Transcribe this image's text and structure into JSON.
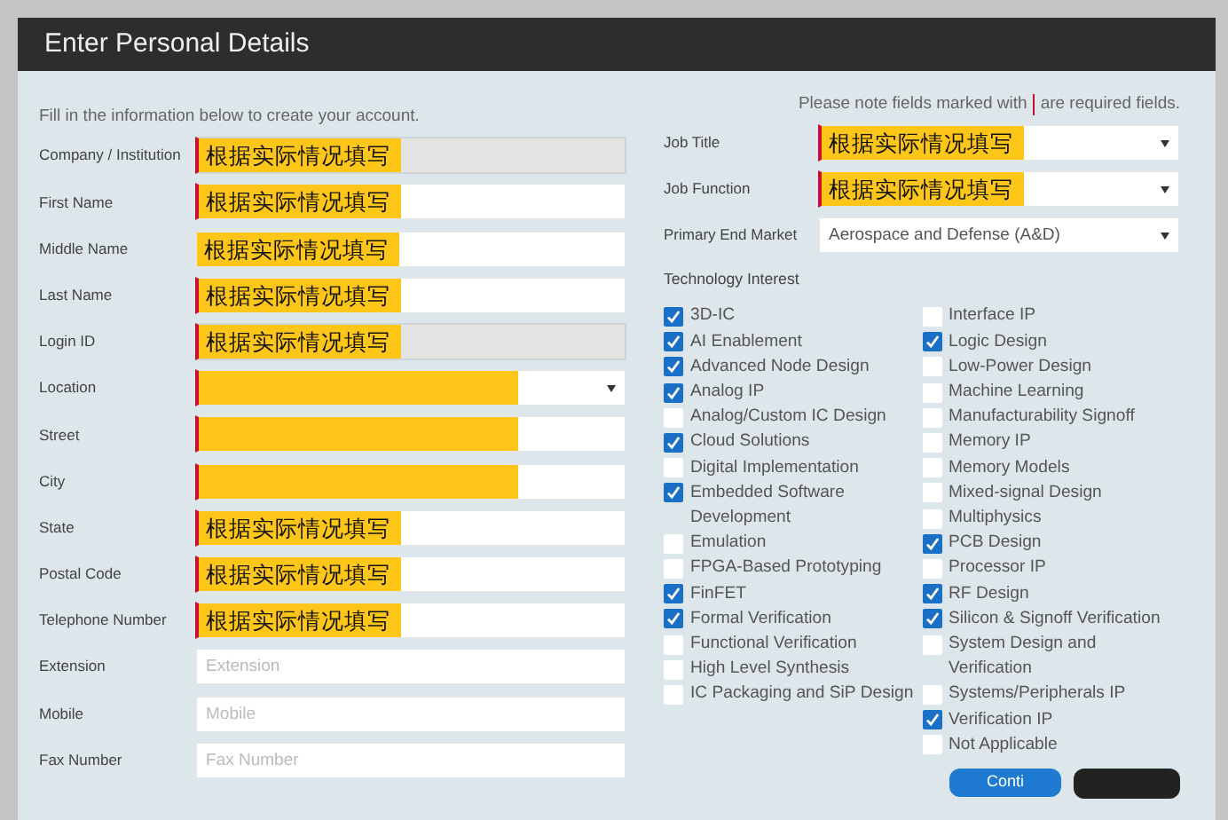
{
  "header": {
    "title": "Enter Personal Details"
  },
  "intro": "Fill in the information below to create your account.",
  "required_note": {
    "before": "Please note fields marked with",
    "after": "are required fields."
  },
  "personal_fields": [
    {
      "label": "Company / Institution",
      "kind": "text",
      "required": true,
      "value": "根据实际情况填写",
      "highlighted": true,
      "disabled": true
    },
    {
      "label": "First Name",
      "kind": "text",
      "required": true,
      "value": "根据实际情况填写",
      "highlighted": true,
      "disabled": false
    },
    {
      "label": "Middle Name",
      "kind": "text",
      "required": false,
      "value": "根据实际情况填写",
      "highlighted": true,
      "disabled": false
    },
    {
      "label": "Last Name",
      "kind": "text",
      "required": true,
      "value": "根据实际情况填写",
      "highlighted": true,
      "disabled": false
    },
    {
      "label": "Login ID",
      "kind": "text",
      "required": true,
      "value": "根据实际情况填写",
      "highlighted": true,
      "disabled": true
    },
    {
      "label": "Location",
      "kind": "select",
      "required": true,
      "highlighted": true,
      "disabled": false
    },
    {
      "label": "Street",
      "kind": "text",
      "required": true,
      "highlighted": true,
      "disabled": false
    },
    {
      "label": "City",
      "kind": "text",
      "required": true,
      "highlighted": true,
      "disabled": false
    },
    {
      "label": "State",
      "kind": "text",
      "required": true,
      "value": "根据实际情况填写",
      "highlighted": true,
      "disabled": false
    },
    {
      "label": "Postal Code",
      "kind": "text",
      "required": true,
      "value": "根据实际情况填写",
      "highlighted": true,
      "disabled": false
    },
    {
      "label": "Telephone Number",
      "kind": "text",
      "required": true,
      "value": "根据实际情况填写",
      "highlighted": true,
      "disabled": false
    },
    {
      "label": "Extension",
      "kind": "text",
      "required": false,
      "placeholder": "Extension",
      "highlighted": false,
      "disabled": false
    },
    {
      "label": "Mobile",
      "kind": "text",
      "required": false,
      "placeholder": "Mobile",
      "highlighted": false,
      "disabled": false
    },
    {
      "label": "Fax Number",
      "kind": "text",
      "required": false,
      "placeholder": "Fax Number",
      "highlighted": false,
      "disabled": false
    }
  ],
  "job_fields": [
    {
      "label": "Job Title",
      "kind": "select",
      "required": true,
      "value": "根据实际情况填写",
      "highlighted": true
    },
    {
      "label": "Job Function",
      "kind": "select",
      "required": true,
      "value": "根据实际情况填写",
      "highlighted": true
    },
    {
      "label": "Primary End Market",
      "kind": "select",
      "required": false,
      "value": "Aerospace and Defense (A&D)",
      "highlighted": false
    }
  ],
  "technology_interest": {
    "title": "Technology Interest",
    "columns": [
      [
        {
          "label": "3D-IC",
          "checked": true
        },
        {
          "label": "AI Enablement",
          "checked": true
        },
        {
          "label": "Advanced Node Design",
          "checked": true
        },
        {
          "label": "Analog IP",
          "checked": true
        },
        {
          "label": "Analog/Custom IC Design",
          "checked": false
        },
        {
          "label": "Cloud Solutions",
          "checked": true
        },
        {
          "label": "Digital Implementation",
          "checked": false
        },
        {
          "label": "Embedded Software Development",
          "checked": true
        },
        {
          "label": "Emulation",
          "checked": false
        },
        {
          "label": "FPGA-Based Prototyping",
          "checked": false
        },
        {
          "label": "FinFET",
          "checked": true
        },
        {
          "label": "Formal Verification",
          "checked": true
        },
        {
          "label": "Functional Verification",
          "checked": false
        },
        {
          "label": "High Level Synthesis",
          "checked": false
        },
        {
          "label": "IC Packaging and SiP Design",
          "checked": false
        }
      ],
      [
        {
          "label": "Interface IP",
          "checked": false
        },
        {
          "label": "Logic Design",
          "checked": true
        },
        {
          "label": "Low-Power Design",
          "checked": false
        },
        {
          "label": "Machine Learning",
          "checked": false
        },
        {
          "label": "Manufacturability Signoff",
          "checked": false
        },
        {
          "label": "Memory IP",
          "checked": false
        },
        {
          "label": "Memory Models",
          "checked": false
        },
        {
          "label": "Mixed-signal Design",
          "checked": false
        },
        {
          "label": "Multiphysics",
          "checked": false
        },
        {
          "label": "PCB Design",
          "checked": true
        },
        {
          "label": "Processor IP",
          "checked": false
        },
        {
          "label": "RF Design",
          "checked": true
        },
        {
          "label": "Silicon & Signoff Verification",
          "checked": true
        },
        {
          "label": "System Design and Verification",
          "checked": false
        },
        {
          "label": "Systems/Peripherals IP",
          "checked": false
        },
        {
          "label": "Verification IP",
          "checked": true
        },
        {
          "label": "Not Applicable",
          "checked": false
        }
      ]
    ]
  },
  "buttons": [
    {
      "label": "Conti",
      "kind": "primary"
    },
    {
      "kind": "dark"
    }
  ]
}
